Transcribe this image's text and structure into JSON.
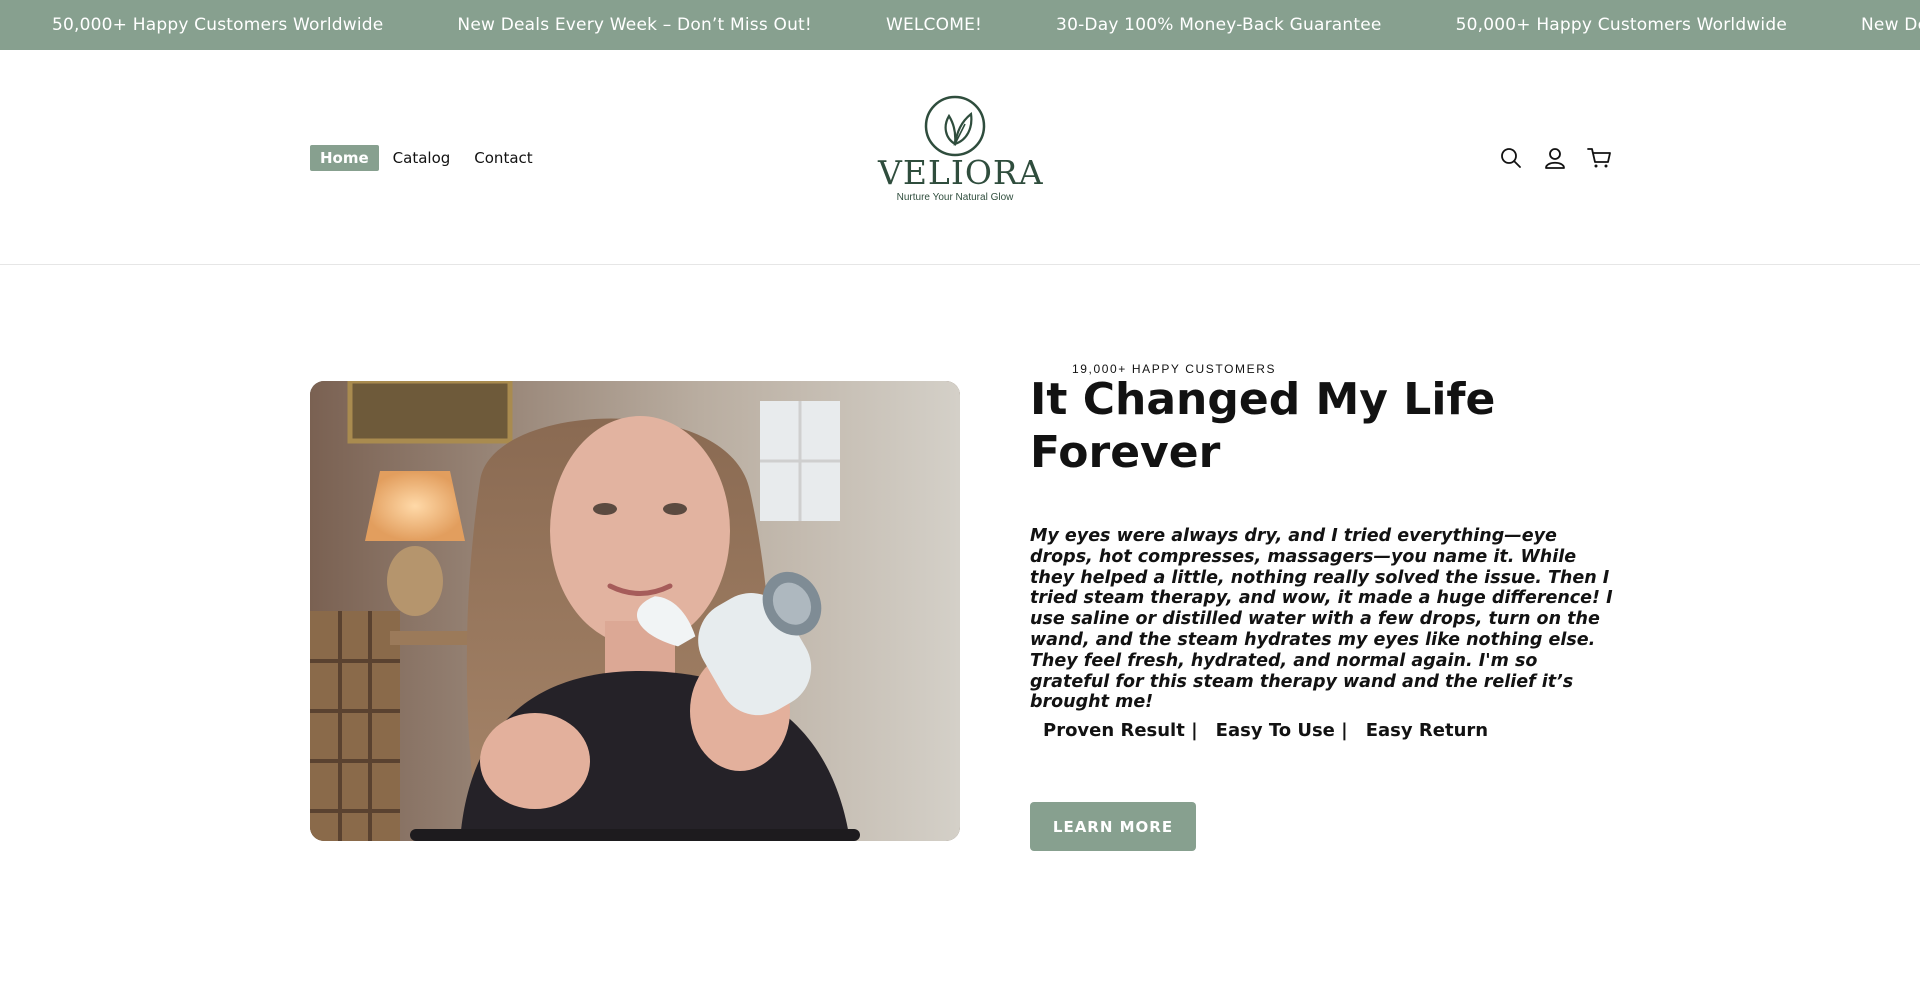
{
  "announcement": {
    "items": [
      "50,000+ Happy Customers Worldwide",
      "New Deals Every Week – Don’t Miss Out!",
      "WELCOME!",
      "30-Day 100% Money-Back Guarantee",
      "50,000+ Happy Customers Worldwide",
      "New Deals Every Week – Don’t Miss Out!"
    ]
  },
  "nav": {
    "items": [
      "Home",
      "Catalog",
      "Contact"
    ],
    "active": "Home"
  },
  "logo": {
    "name": "VELIORA",
    "tagline": "Nurture Your Natural Glow"
  },
  "header_icons": [
    "search-icon",
    "account-icon",
    "cart-icon"
  ],
  "hero": {
    "eyebrow": "19,000+ HAPPY CUSTOMERS",
    "title": "It Changed My Life Forever",
    "quote": "My eyes were always dry, and I tried everything—eye drops, hot compresses, massagers—you name it. While they helped a little, nothing really solved the issue. Then I tried steam therapy, and wow, it made a huge difference! I use saline or distilled water with a few drops, turn on the wand, and the steam hydrates my eyes like nothing else. They feel fresh, hydrated, and normal again. I'm so grateful for this steam therapy wand and the relief it’s brought me!",
    "features": [
      "Proven Result |",
      "Easy To Use |",
      "Easy Return"
    ],
    "button": "LEARN MORE"
  },
  "colors": {
    "accent": "#87a08f",
    "logo": "#2f4d3d",
    "text": "#121212"
  }
}
